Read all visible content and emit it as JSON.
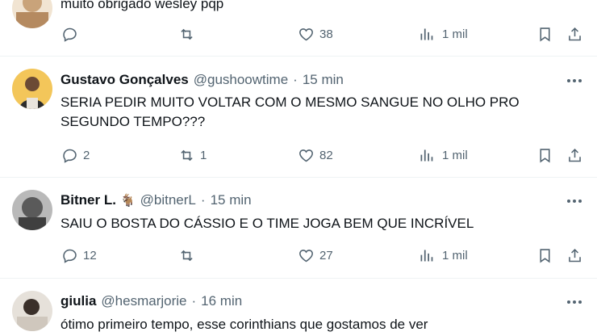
{
  "tweets": [
    {
      "name": "",
      "handle": "",
      "time": "",
      "text": "muito obrigado wesley pqp",
      "replies": "",
      "retweets": "",
      "likes": "38",
      "views": "1 mil",
      "avatar_color": "#c9a37a"
    },
    {
      "name": "Gustavo Gonçalves",
      "handle": "@gushoowtime",
      "time": "15 min",
      "text": "SERIA PEDIR MUITO VOLTAR COM O MESMO SANGUE NO OLHO PRO SEGUNDO TEMPO???",
      "replies": "2",
      "retweets": "1",
      "likes": "82",
      "views": "1 mil",
      "avatar_color": "#e9b84a"
    },
    {
      "name": "Bitner L.",
      "name_emoji": "🐐",
      "handle": "@bitnerL",
      "time": "15 min",
      "text": "SAIU O BOSTA DO CÁSSIO E O TIME JOGA BEM QUE INCRÍVEL",
      "replies": "12",
      "retweets": "",
      "likes": "27",
      "views": "1 mil",
      "avatar_color": "#8a8a8a"
    },
    {
      "name": "giulia",
      "handle": "@hesmarjorie",
      "time": "16 min",
      "text": "ótimo primeiro tempo, esse corinthians que gostamos de ver",
      "avatar_color": "#d8d3cc"
    }
  ],
  "header_dot": "·",
  "icons": {
    "reply": "reply-icon",
    "retweet": "retweet-icon",
    "like": "heart-icon",
    "views": "views-icon",
    "bookmark": "bookmark-icon",
    "share": "share-icon",
    "more": "more-icon"
  },
  "colors": {
    "text": "#0f1419",
    "secondary": "#536471",
    "divider": "#eff3f4"
  }
}
